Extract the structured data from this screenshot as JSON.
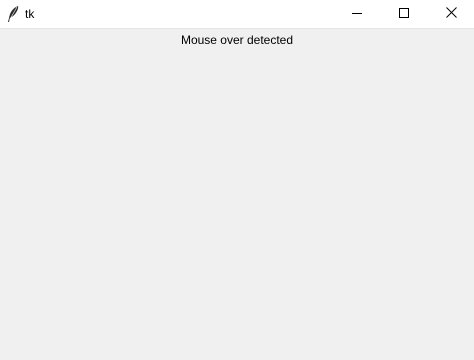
{
  "window": {
    "title": "tk",
    "app_icon": "feather-icon"
  },
  "controls": {
    "minimize_icon": "minimize-icon",
    "maximize_icon": "maximize-icon",
    "close_icon": "close-icon"
  },
  "content": {
    "status_text": "Mouse over detected"
  },
  "colors": {
    "titlebar_bg": "#ffffff",
    "client_bg": "#f0f0f0",
    "text": "#000000"
  }
}
